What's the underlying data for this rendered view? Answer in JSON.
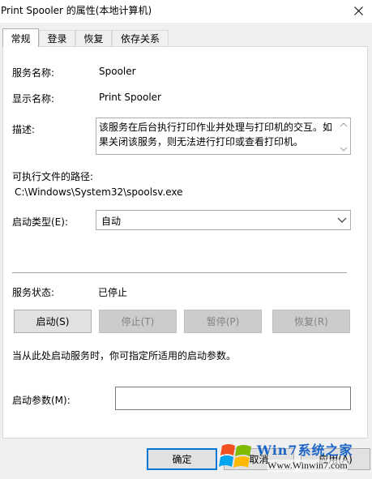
{
  "window": {
    "title": "Print Spooler 的属性(本地计算机)",
    "close_icon": "close-icon"
  },
  "tabs": [
    {
      "label": "常规",
      "active": true
    },
    {
      "label": "登录",
      "active": false
    },
    {
      "label": "恢复",
      "active": false
    },
    {
      "label": "依存关系",
      "active": false
    }
  ],
  "general": {
    "service_name_label": "服务名称:",
    "service_name_value": "Spooler",
    "display_name_label": "显示名称:",
    "display_name_value": "Print Spooler",
    "description_label": "描述:",
    "description_value": "该服务在后台执行打印作业并处理与打印机的交互。如果关闭该服务，则无法进行打印或查看打印机。",
    "exe_path_label": "可执行文件的路径:",
    "exe_path_value": "C:\\Windows\\System32\\spoolsv.exe",
    "startup_type_label": "启动类型(E):",
    "startup_type_value": "自动",
    "service_status_label": "服务状态:",
    "service_status_value": "已停止",
    "buttons": {
      "start": "启动(S)",
      "stop": "停止(T)",
      "pause": "暂停(P)",
      "resume": "恢复(R)"
    },
    "hint_text": "当从此处启动服务时，你可指定所适用的启动参数。",
    "start_params_label": "启动参数(M):",
    "start_params_value": ""
  },
  "footer": {
    "ok": "确定",
    "cancel": "取消",
    "apply": "应用(A)"
  },
  "watermark": {
    "brand": "Win7系统之家",
    "url": "Www.Winwin7.com"
  },
  "colors": {
    "accent": "#0078d7",
    "panel_bg": "#f0f0f0",
    "disabled_text": "#838383"
  }
}
